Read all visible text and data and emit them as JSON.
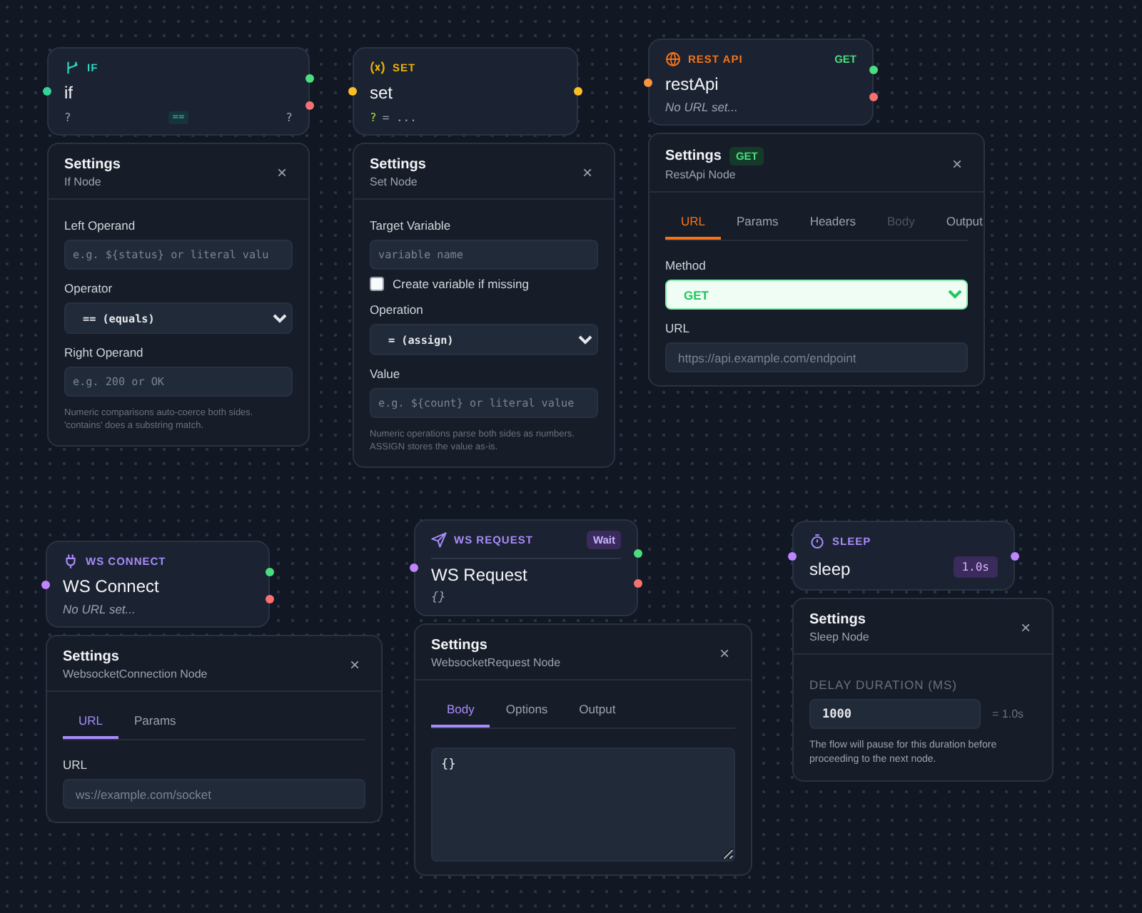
{
  "nodes": [
    {
      "kind": "if",
      "type_label": "IF",
      "color": "#2dd4bf",
      "title": "if",
      "footer": [
        {
          "kind": "operand",
          "text": "?"
        },
        {
          "kind": "operator",
          "text": "=="
        },
        {
          "kind": "operand",
          "text": "?"
        }
      ],
      "ports": [
        {
          "kind": "in",
          "color": "#34d399"
        },
        {
          "kind": "out",
          "color": "#4ade80"
        },
        {
          "kind": "error",
          "color": "#f87171"
        }
      ],
      "panel": {
        "title": "Settings",
        "subtitle": "If Node",
        "close_label": "×",
        "fields": [
          {
            "kind": "code_input",
            "label": "Left Operand",
            "placeholder": "e.g. ${status} or literal valu"
          },
          {
            "kind": "select",
            "label": "Operator",
            "value": "== (equals)"
          },
          {
            "kind": "code_input",
            "label": "Right Operand",
            "placeholder": "e.g. 200 or OK"
          }
        ],
        "note": "Numeric comparisons auto-coerce both sides. 'contains' does a substring match."
      }
    },
    {
      "kind": "set",
      "type_label": "SET",
      "color": "#eab308",
      "title": "set",
      "footer": [
        {
          "kind": "target",
          "text": "?"
        },
        {
          "kind": "expr",
          "text": "= ..."
        }
      ],
      "ports": [
        {
          "kind": "in",
          "color": "#fbbf24"
        },
        {
          "kind": "out",
          "color": "#fbbf24"
        }
      ],
      "panel": {
        "title": "Settings",
        "subtitle": "Set Node",
        "close_label": "×",
        "fields": [
          {
            "kind": "code_input",
            "label": "Target Variable",
            "placeholder": "variable name"
          },
          {
            "kind": "checkbox",
            "label": "Create variable if missing",
            "checked": false
          },
          {
            "kind": "select",
            "label": "Operation",
            "value": "= (assign)"
          },
          {
            "kind": "code_input",
            "label": "Value",
            "placeholder": "e.g. ${count} or literal value"
          }
        ],
        "note": "Numeric operations parse both sides as numbers. ASSIGN stores the value as-is."
      }
    },
    {
      "kind": "rest",
      "type_label": "REST API",
      "color": "#f97316",
      "header_badge": "GET",
      "title": "restApi",
      "subtitle": "No URL set...",
      "ports": [
        {
          "kind": "in",
          "color": "#fb923c"
        },
        {
          "kind": "out",
          "color": "#4ade80"
        },
        {
          "kind": "error",
          "color": "#f87171"
        }
      ],
      "panel": {
        "title": "Settings",
        "badge": "GET",
        "subtitle": "RestApi Node",
        "close_label": "×",
        "tabs": [
          {
            "label": "URL",
            "selected": true,
            "disabled": false
          },
          {
            "label": "Params",
            "selected": false,
            "disabled": false
          },
          {
            "label": "Headers",
            "selected": false,
            "disabled": false
          },
          {
            "label": "Body",
            "selected": false,
            "disabled": true
          },
          {
            "label": "Output",
            "selected": false,
            "disabled": false
          }
        ],
        "fields": [
          {
            "kind": "method_select",
            "label": "Method",
            "value": "GET"
          },
          {
            "kind": "input",
            "label": "URL",
            "placeholder": "https://api.example.com/endpoint"
          }
        ]
      }
    },
    {
      "kind": "ws_connect",
      "type_label": "WS CONNECT",
      "color": "#a78bfa",
      "title": "WS Connect",
      "subtitle": "No URL set...",
      "ports": [
        {
          "kind": "in",
          "color": "#c084fc"
        },
        {
          "kind": "out",
          "color": "#4ade80"
        },
        {
          "kind": "error",
          "color": "#f87171"
        }
      ],
      "panel": {
        "title": "Settings",
        "subtitle": "WebsocketConnection Node",
        "close_label": "×",
        "tabs": [
          {
            "label": "URL",
            "selected": true,
            "disabled": false
          },
          {
            "label": "Params",
            "selected": false,
            "disabled": false
          }
        ],
        "fields": [
          {
            "kind": "input",
            "label": "URL",
            "placeholder": "ws://example.com/socket"
          }
        ]
      }
    },
    {
      "kind": "ws_request",
      "type_label": "WS REQUEST",
      "color": "#a78bfa",
      "header_badge": "Wait",
      "title": "WS Request",
      "subtitle": "{}",
      "ports": [
        {
          "kind": "in",
          "color": "#c084fc"
        },
        {
          "kind": "out",
          "color": "#4ade80"
        },
        {
          "kind": "error",
          "color": "#f87171"
        }
      ],
      "panel": {
        "title": "Settings",
        "subtitle": "WebsocketRequest Node",
        "close_label": "×",
        "tabs": [
          {
            "label": "Body",
            "selected": true,
            "disabled": false
          },
          {
            "label": "Options",
            "selected": false,
            "disabled": false
          },
          {
            "label": "Output",
            "selected": false,
            "disabled": false
          }
        ],
        "fields": [
          {
            "kind": "textarea",
            "value": "{}"
          }
        ]
      }
    },
    {
      "kind": "sleep",
      "type_label": "SLEEP",
      "color": "#a78bfa",
      "title": "sleep",
      "title_badge": "1.0s",
      "ports": [
        {
          "kind": "in",
          "color": "#c084fc"
        },
        {
          "kind": "out",
          "color": "#c084fc"
        }
      ],
      "panel": {
        "title": "Settings",
        "subtitle": "Sleep Node",
        "close_label": "×",
        "fields": [
          {
            "kind": "number_input",
            "label": "DELAY DURATION (MS)",
            "value": "1000",
            "suffix": "= 1.0s"
          }
        ],
        "note": "The flow will pause for this duration before proceeding to the next node."
      }
    }
  ]
}
